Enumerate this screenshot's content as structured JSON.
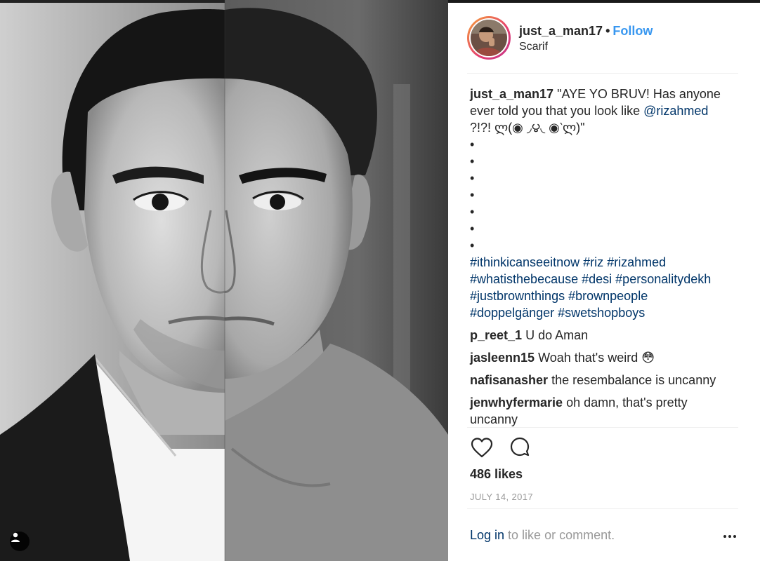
{
  "post": {
    "username": "just_a_man17",
    "separator": "•",
    "follow_label": "Follow",
    "location": "Scarif"
  },
  "caption": {
    "username": "just_a_man17",
    "text_before_mention": "\"AYE YO BRUV! Has anyone ever told you that you look like ",
    "mention": "@rizahmed",
    "text_after_mention": " ?!?! ლ(◉ ◞౪◟ ◉‵ლ)\"",
    "bullets": [
      "•",
      "•",
      "•",
      "•",
      "•",
      "•",
      "•"
    ],
    "hashtags": [
      "#ithinkicanseeitnow",
      "#riz",
      "#rizahmed",
      "#whatisthebecause",
      "#desi",
      "#personalitydekh",
      "#justbrownthings",
      "#brownpeople",
      "#doppelgänger",
      "#swetshopboys"
    ]
  },
  "comments": [
    {
      "username": "p_reet_1",
      "text": "U do Aman"
    },
    {
      "username": "jasleenn15",
      "text": "Woah that's weird 😳"
    },
    {
      "username": "nafisanasher",
      "text": "the resembalance is uncanny"
    },
    {
      "username": "jenwhyfermarie",
      "text": "oh damn, that's pretty uncanny"
    }
  ],
  "actions": {
    "like_icon": "heart-icon",
    "comment_icon": "comment-bubble-icon"
  },
  "likes_label": "486 likes",
  "date_label": "JULY 14, 2017",
  "login": {
    "link_label": "Log in",
    "rest_label": " to like or comment."
  },
  "more_icon": "more-options-icon",
  "tag_icon": "user-tag-icon",
  "colors": {
    "link": "#003569",
    "follow": "#3897f0",
    "muted": "#999999",
    "text": "#262626"
  }
}
